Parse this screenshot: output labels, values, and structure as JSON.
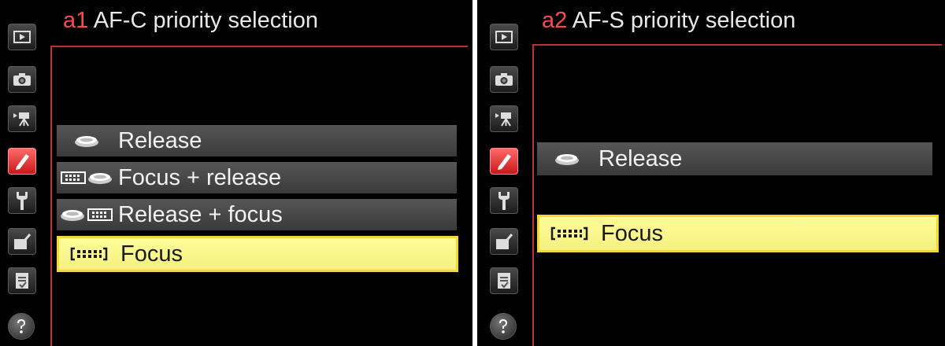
{
  "screens": [
    {
      "title_code": "a1",
      "title_text": "AF-C priority selection",
      "options": [
        {
          "label": "Release",
          "icon": "release-icon",
          "selected": false
        },
        {
          "label": "Focus + release",
          "icon": "focus-release-icon",
          "selected": false
        },
        {
          "label": "Release + focus",
          "icon": "release-focus-icon",
          "selected": false
        },
        {
          "label": "Focus",
          "icon": "focus-icon",
          "selected": true
        }
      ]
    },
    {
      "title_code": "a2",
      "title_text": "AF-S priority selection",
      "options": [
        {
          "label": "Release",
          "icon": "release-icon",
          "selected": false
        },
        {
          "label": "Focus",
          "icon": "focus-icon",
          "selected": true
        }
      ]
    }
  ],
  "sidebar": {
    "tabs": [
      {
        "icon": "playback-icon"
      },
      {
        "icon": "camera-icon"
      },
      {
        "icon": "movie-icon"
      },
      {
        "icon": "pencil-icon",
        "active": true
      },
      {
        "icon": "wrench-icon"
      },
      {
        "icon": "retouch-icon"
      },
      {
        "icon": "recent-settings-icon"
      },
      {
        "icon": "help-icon"
      }
    ]
  },
  "colors": {
    "title_code": "#ff4a4a",
    "selected_row": "#fffd9a",
    "selected_border": "#f3d838",
    "active_tab": "#e02a2a",
    "frame_line": "#c03030"
  }
}
